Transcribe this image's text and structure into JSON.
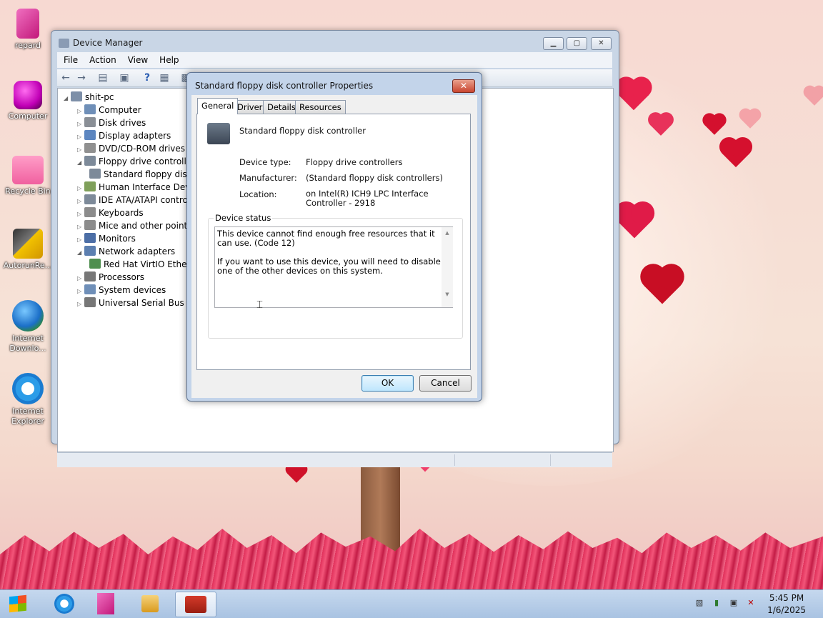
{
  "desktop": {
    "icons": [
      {
        "label": "repard",
        "icon": "folder-icon"
      },
      {
        "label": "Computer",
        "icon": "computer-icon"
      },
      {
        "label": "Recycle Bin",
        "icon": "recycle-bin-icon"
      },
      {
        "label": "AutorunRe...",
        "icon": "autorun-icon"
      },
      {
        "label": "Internet Downlo...",
        "icon": "idm-icon"
      },
      {
        "label": "Internet Explorer",
        "icon": "ie-icon"
      }
    ]
  },
  "device_manager": {
    "title": "Device Manager",
    "menu": [
      "File",
      "Action",
      "View",
      "Help"
    ],
    "tree": {
      "root": "shit-pc",
      "items": [
        {
          "label": "Computer",
          "expanded": false
        },
        {
          "label": "Disk drives",
          "expanded": false
        },
        {
          "label": "Display adapters",
          "expanded": false
        },
        {
          "label": "DVD/CD-ROM drives",
          "expanded": false
        },
        {
          "label": "Floppy drive controllers",
          "expanded": true
        },
        {
          "label": "Standard floppy disk controller",
          "child": true
        },
        {
          "label": "Human Interface Devices",
          "expanded": false
        },
        {
          "label": "IDE ATA/ATAPI controllers",
          "expanded": false
        },
        {
          "label": "Keyboards",
          "expanded": false
        },
        {
          "label": "Mice and other pointing devices",
          "expanded": false
        },
        {
          "label": "Monitors",
          "expanded": false
        },
        {
          "label": "Network adapters",
          "expanded": true
        },
        {
          "label": "Red Hat VirtIO Ethernet Adapter",
          "child": true
        },
        {
          "label": "Processors",
          "expanded": false
        },
        {
          "label": "System devices",
          "expanded": false
        },
        {
          "label": "Universal Serial Bus controllers",
          "expanded": false
        }
      ]
    }
  },
  "dialog": {
    "title": "Standard floppy disk controller Properties",
    "tabs": [
      "General",
      "Driver",
      "Details",
      "Resources"
    ],
    "device_name": "Standard floppy disk controller",
    "device_type_label": "Device type:",
    "device_type_value": "Floppy drive controllers",
    "manufacturer_label": "Manufacturer:",
    "manufacturer_value": "(Standard floppy disk controllers)",
    "location_label": "Location:",
    "location_value": "on Intel(R) ICH9 LPC Interface Controller - 2918",
    "status_group_label": "Device status",
    "status_text": "This device cannot find enough free resources that it can use. (Code 12)\n\nIf you want to use this device, you will need to disable one of the other devices on this system.",
    "ok_label": "OK",
    "cancel_label": "Cancel"
  },
  "taskbar": {
    "time": "5:45 PM",
    "date": "1/6/2025"
  }
}
